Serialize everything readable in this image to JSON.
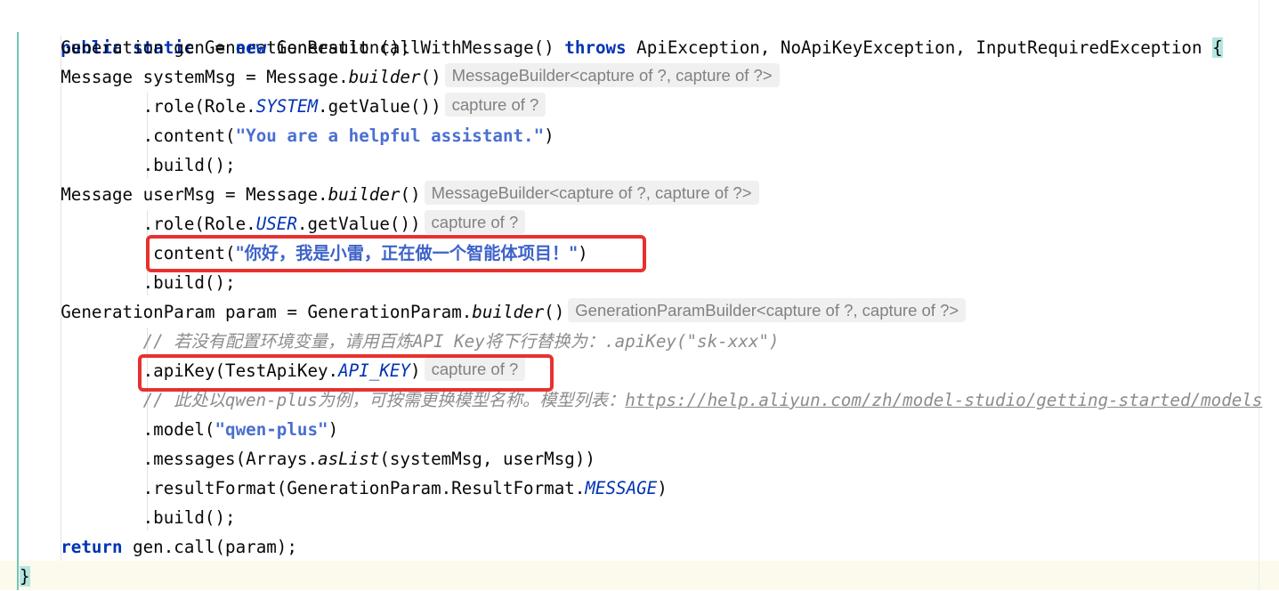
{
  "code": {
    "l1": {
      "kw_public": "public",
      "kw_static": "static",
      "sig": "GenerationResult callWithMessage()",
      "kw_throws": "throws",
      "exceptions": "ApiException, NoApiKeyException, InputRequiredException",
      "brace": "{"
    },
    "l2": {
      "a": "Generation gen = ",
      "kw_new": "new",
      "b": "Generation();"
    },
    "l3": {
      "a": "Message systemMsg = Message.",
      "method": "builder",
      "b": "()",
      "hint": "MessageBuilder<capture of ?, capture of ?>"
    },
    "l4": {
      "a": ".role(Role.",
      "field": "SYSTEM",
      "b": ".getValue())",
      "hint": "capture of ?"
    },
    "l5": {
      "a": ".content(",
      "str": "\"You are a helpful assistant.\"",
      "b": ")"
    },
    "l6": {
      "a": ".build();"
    },
    "l7": {
      "a": "Message userMsg = Message.",
      "method": "builder",
      "b": "()",
      "hint": "MessageBuilder<capture of ?, capture of ?>"
    },
    "l8": {
      "a": ".role(Role.",
      "field": "USER",
      "b": ".getValue())",
      "hint": "capture of ?"
    },
    "l9": {
      "a": ".content(",
      "str": "\"你好，我是小雷，正在做一个智能体项目！\"",
      "b": ")"
    },
    "l10": {
      "a": ".build();"
    },
    "l11": {
      "a": "GenerationParam param = GenerationParam.",
      "method": "builder",
      "b": "()",
      "hint": "GenerationParamBuilder<capture of ?, capture of ?>"
    },
    "l12": {
      "comment": "// 若没有配置环境变量，请用百炼API Key将下行替换为：.apiKey(\"sk-xxx\")"
    },
    "l13": {
      "a": ".apiKey(TestApiKey.",
      "field": "API_KEY",
      "b": ")",
      "hint": "capture of ?"
    },
    "l14": {
      "comment": "// 此处以qwen-plus为例，可按需更换模型名称。模型列表：",
      "link": "https://help.aliyun.com/zh/model-studio/getting-started/models"
    },
    "l15": {
      "a": ".model(",
      "str": "\"qwen-plus\"",
      "b": ")"
    },
    "l16": {
      "a": ".messages(Arrays.",
      "method": "asList",
      "b": "(systemMsg, userMsg))"
    },
    "l17": {
      "a": ".resultFormat(GenerationParam.ResultFormat.",
      "field": "MESSAGE",
      "b": ")"
    },
    "l18": {
      "a": ".build();"
    },
    "l19": {
      "kw_return": "return",
      "a": " gen.call(param);"
    },
    "l20": {
      "brace": "}"
    }
  },
  "annotations": {
    "highlight_color": "#e8312f",
    "highlighted_lines": [
      "userMsg .content(...)",
      ".apiKey(TestApiKey.API_KEY)"
    ]
  },
  "colors": {
    "keyword": "#0033b3",
    "string": "#4a6fd0",
    "comment": "#8c8c8c",
    "inlay_hint_bg": "#f0f0f0",
    "gutter_change_bar": "#6fc7b6"
  }
}
